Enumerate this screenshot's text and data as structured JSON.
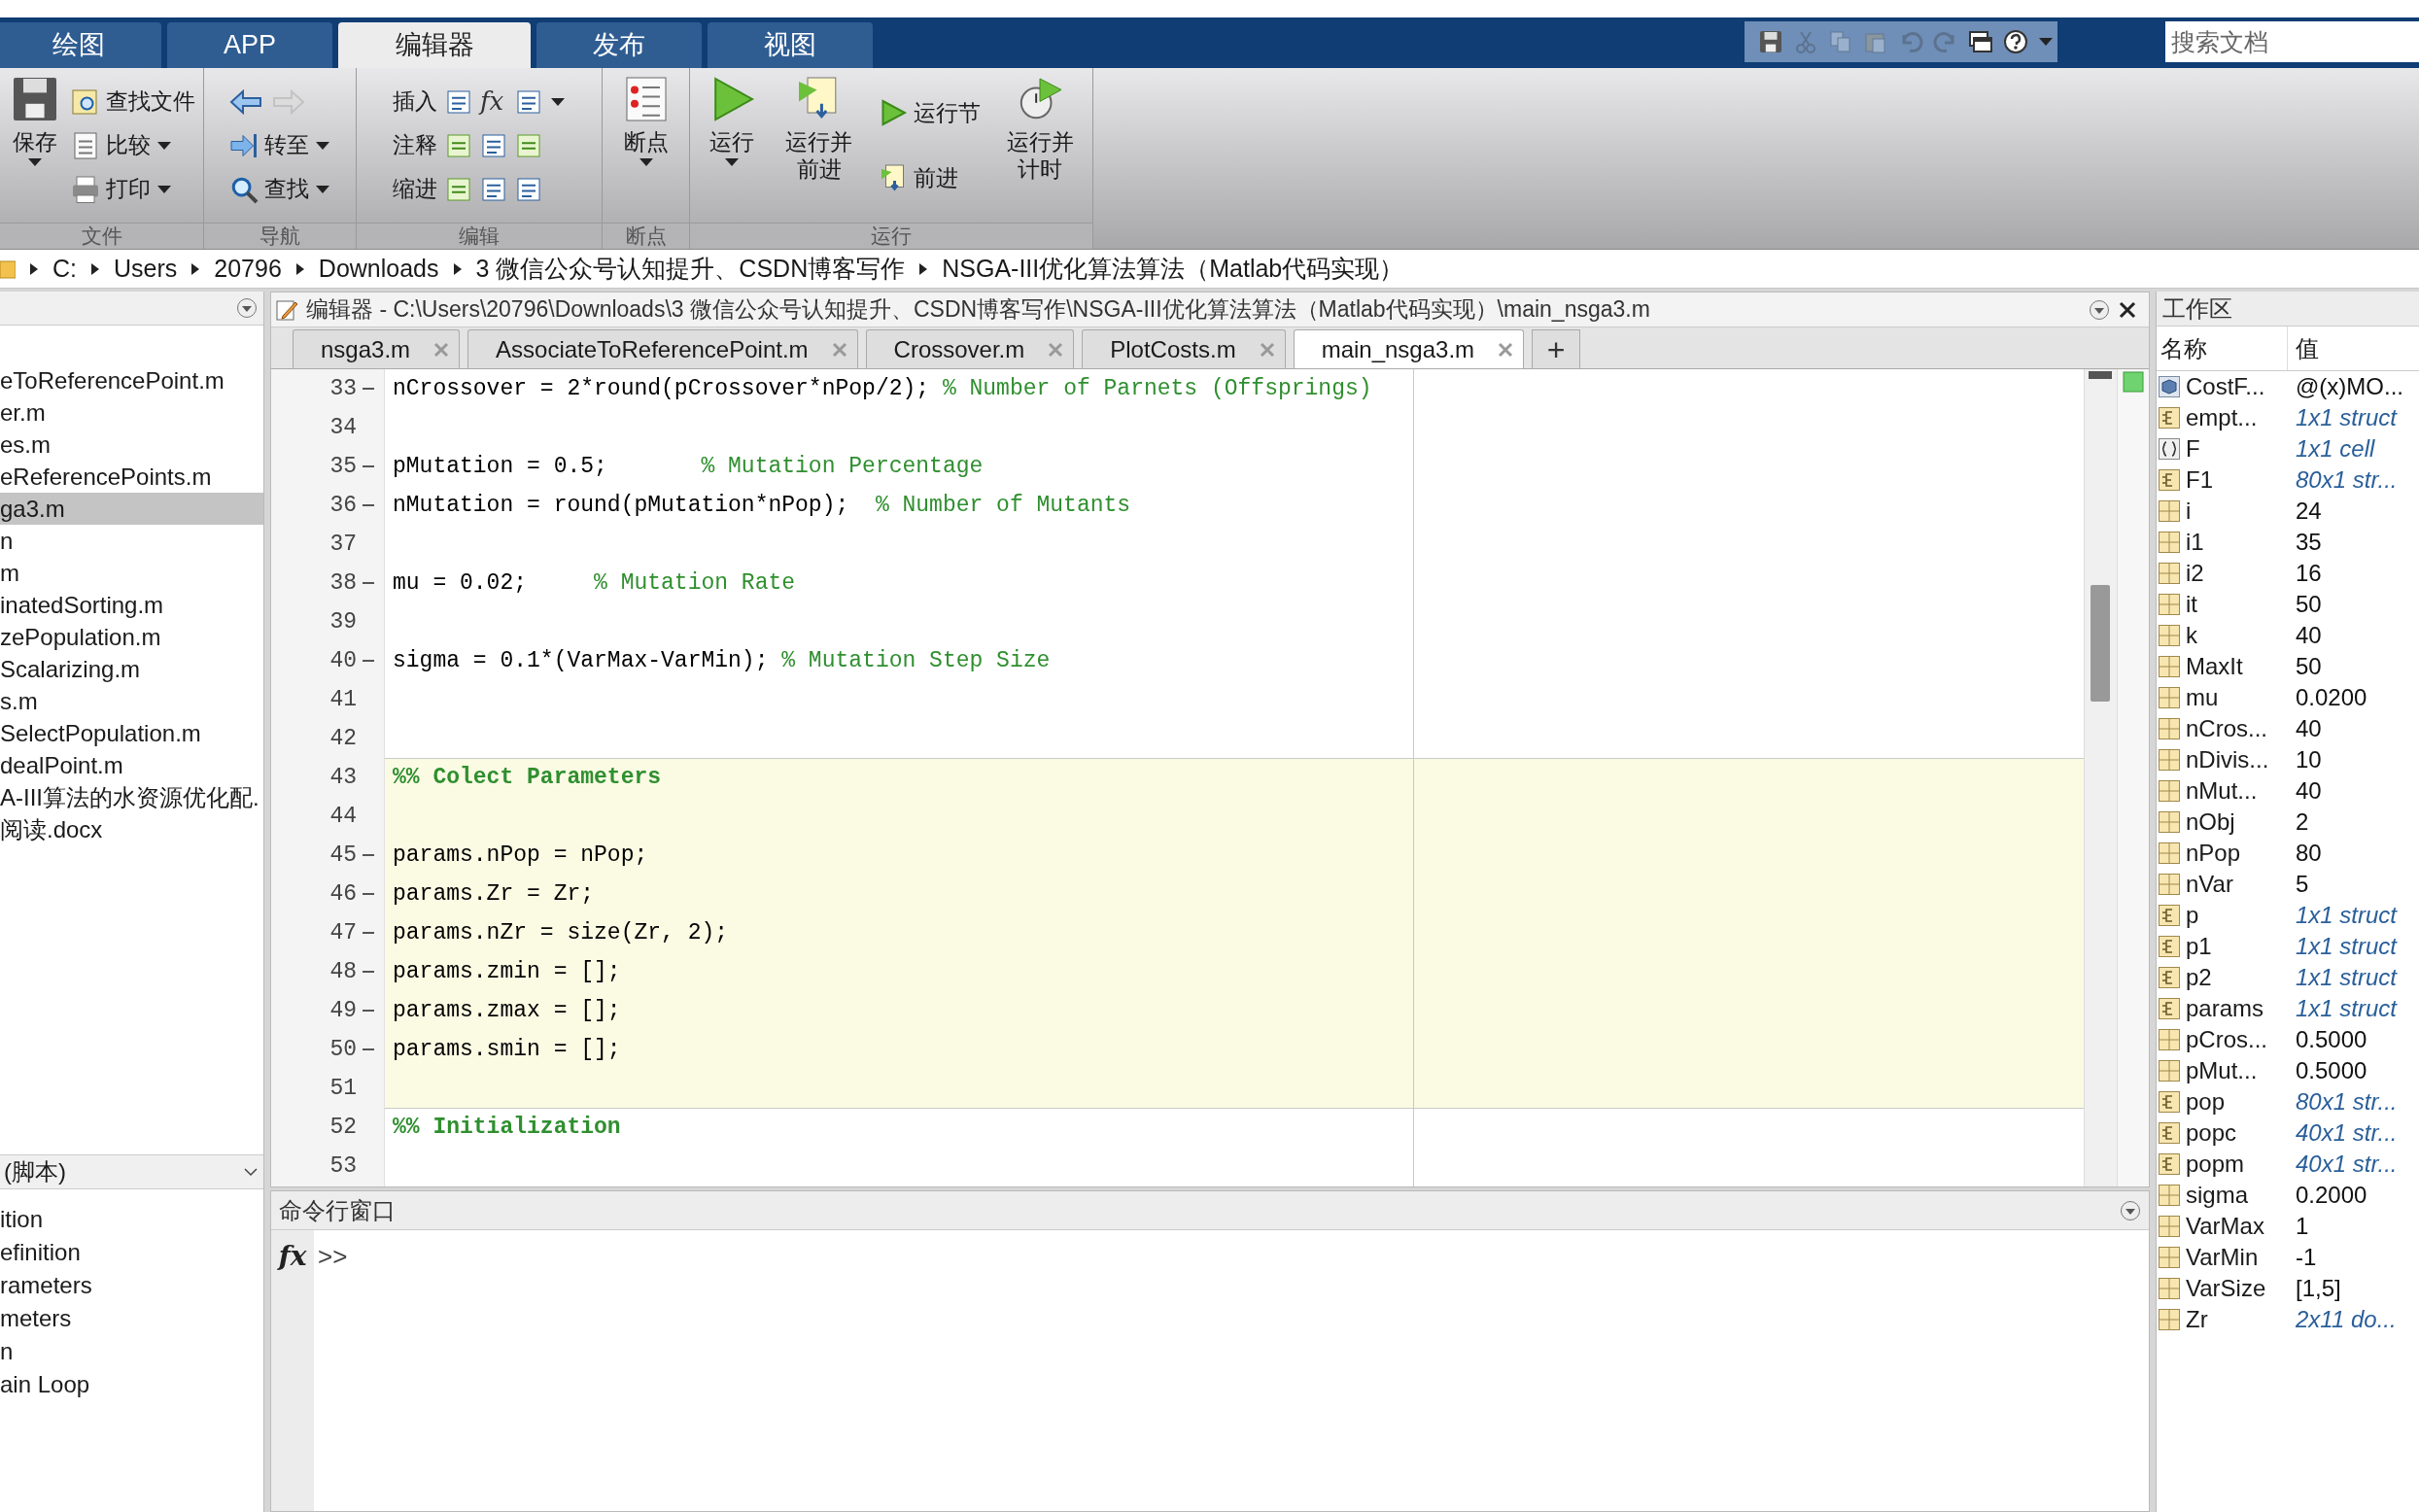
{
  "ribbon_tabs": [
    {
      "label": "绘图",
      "selected": false
    },
    {
      "label": "APP",
      "selected": false
    },
    {
      "label": "编辑器",
      "selected": true
    },
    {
      "label": "发布",
      "selected": false
    },
    {
      "label": "视图",
      "selected": false
    }
  ],
  "quick_access": [
    {
      "disabled": false
    },
    {
      "disabled": true
    },
    {
      "disabled": true
    },
    {
      "disabled": true
    },
    {
      "disabled": true
    },
    {
      "disabled": true
    },
    {
      "disabled": false
    },
    {
      "disabled": false
    }
  ],
  "search": {
    "placeholder": "搜索文档"
  },
  "ribbon_groups": [
    {
      "label": "文件",
      "columns": [
        {
          "kind": "large",
          "label_lines": [
            "保存"
          ],
          "dropdown": true
        },
        {
          "kind": "stack",
          "items": [
            {
              "kind": "command",
              "label": "查找文件",
              "dropdown": false
            },
            {
              "kind": "command",
              "label": "比较",
              "dropdown": true
            },
            {
              "kind": "command",
              "label": "打印",
              "dropdown": true
            }
          ]
        }
      ]
    },
    {
      "label": "导航",
      "columns": [
        {
          "kind": "stack",
          "items": [
            {
              "kind": "arrows",
              "forward_enabled": false
            },
            {
              "kind": "command",
              "label": "转至",
              "dropdown": true
            },
            {
              "kind": "command",
              "label": "查找",
              "dropdown": true
            }
          ]
        }
      ]
    },
    {
      "label": "编辑",
      "columns": [
        {
          "kind": "stack",
          "items": [
            {
              "kind": "edit_row",
              "label": "插入",
              "glyph": "fx",
              "dropdown": true
            },
            {
              "kind": "edit_row",
              "label": "注释",
              "dropdown": false
            },
            {
              "kind": "edit_row",
              "label": "缩进",
              "dropdown": false
            }
          ]
        }
      ]
    },
    {
      "label": "断点",
      "columns": [
        {
          "kind": "large",
          "label_lines": [
            "断点"
          ],
          "dropdown": true
        }
      ]
    },
    {
      "label": "运行",
      "columns": [
        {
          "kind": "large",
          "label_lines": [
            "运行"
          ],
          "dropdown": true
        },
        {
          "kind": "large",
          "label_lines": [
            "运行并",
            "前进"
          ],
          "dropdown": false
        },
        {
          "kind": "stack",
          "items": [
            {
              "kind": "command",
              "label": "运行节",
              "dropdown": false
            },
            {
              "kind": "command",
              "label": "前进",
              "dropdown": false
            }
          ]
        },
        {
          "kind": "large",
          "label_lines": [
            "运行并",
            "计时"
          ],
          "dropdown": false
        }
      ]
    }
  ],
  "address_bar": {
    "segments": [
      "C:",
      "Users",
      "20796",
      "Downloads",
      "3 微信公众号认知提升、CSDN博客写作",
      "NSGA-III优化算法算法（Matlab代码实现）"
    ]
  },
  "file_browser": {
    "files": [
      {
        "name": "eToReferencePoint.m",
        "selected": false
      },
      {
        "name": "er.m",
        "selected": false
      },
      {
        "name": "es.m",
        "selected": false
      },
      {
        "name": "eReferencePoints.m",
        "selected": false
      },
      {
        "name": "ga3.m",
        "selected": true
      },
      {
        "name": "n",
        "selected": false
      },
      {
        "name": "m",
        "selected": false
      },
      {
        "name": "inatedSorting.m",
        "selected": false
      },
      {
        "name": "zePopulation.m",
        "selected": false
      },
      {
        "name": "Scalarizing.m",
        "selected": false
      },
      {
        "name": "s.m",
        "selected": false
      },
      {
        "name": "SelectPopulation.m",
        "selected": false
      },
      {
        "name": "dealPoint.m",
        "selected": false
      },
      {
        "name": "A-III算法的水资源优化配.",
        "selected": false
      },
      {
        "name": "阅读.docx",
        "selected": false
      }
    ],
    "details_title": "(脚本)",
    "sections": [
      "ition",
      "efinition",
      "rameters",
      "meters",
      "n",
      "ain Loop"
    ]
  },
  "editor": {
    "title": "编辑器 - C:\\Users\\20796\\Downloads\\3 微信公众号认知提升、CSDN博客写作\\NSGA-III优化算法算法（Matlab代码实现）\\main_nsga3.m",
    "tabs": [
      {
        "label": "nsga3.m",
        "selected": false
      },
      {
        "label": "AssociateToReferencePoint.m",
        "selected": false
      },
      {
        "label": "Crossover.m",
        "selected": false
      },
      {
        "label": "PlotCosts.m",
        "selected": false
      },
      {
        "label": "main_nsga3.m",
        "selected": true
      }
    ],
    "new_tab": "+",
    "lines": [
      {
        "number": "33",
        "kind": "code",
        "executable": true,
        "highlighted": false,
        "code": "nCrossover = 2*round(pCrossover*nPop/2); ",
        "comment": "% Number of Parnets (Offsprings)"
      },
      {
        "number": "34",
        "kind": "blank",
        "executable": false,
        "highlighted": false
      },
      {
        "number": "35",
        "kind": "code",
        "executable": true,
        "highlighted": false,
        "code": "pMutation = 0.5;       ",
        "comment": "% Mutation Percentage"
      },
      {
        "number": "36",
        "kind": "code",
        "executable": true,
        "highlighted": false,
        "code": "nMutation = round(pMutation*nPop);  ",
        "comment": "% Number of Mutants"
      },
      {
        "number": "37",
        "kind": "blank",
        "executable": false,
        "highlighted": false
      },
      {
        "number": "38",
        "kind": "code",
        "executable": true,
        "highlighted": false,
        "code": "mu = 0.02;     ",
        "comment": "% Mutation Rate"
      },
      {
        "number": "39",
        "kind": "blank",
        "executable": false,
        "highlighted": false
      },
      {
        "number": "40",
        "kind": "code",
        "executable": true,
        "highlighted": false,
        "code": "sigma = 0.1*(VarMax-VarMin); ",
        "comment": "% Mutation Step Size"
      },
      {
        "number": "41",
        "kind": "blank",
        "executable": false,
        "highlighted": false
      },
      {
        "number": "42",
        "kind": "blank",
        "executable": false,
        "highlighted": false
      },
      {
        "number": "43",
        "kind": "section",
        "executable": false,
        "highlighted": true,
        "code": "%% Colect Parameters"
      },
      {
        "number": "44",
        "kind": "blank",
        "executable": false,
        "highlighted": true
      },
      {
        "number": "45",
        "kind": "code",
        "executable": true,
        "highlighted": true,
        "code": "params.nPop = nPop;"
      },
      {
        "number": "46",
        "kind": "code",
        "executable": true,
        "highlighted": true,
        "code": "params.Zr = Zr;"
      },
      {
        "number": "47",
        "kind": "code",
        "executable": true,
        "highlighted": true,
        "code": "params.nZr = size(Zr, 2);"
      },
      {
        "number": "48",
        "kind": "code",
        "executable": true,
        "highlighted": true,
        "code": "params.zmin = [];"
      },
      {
        "number": "49",
        "kind": "code",
        "executable": true,
        "highlighted": true,
        "code": "params.zmax = [];"
      },
      {
        "number": "50",
        "kind": "code",
        "executable": true,
        "highlighted": true,
        "code": "params.smin = [];"
      },
      {
        "number": "51",
        "kind": "blank",
        "executable": false,
        "highlighted": true
      },
      {
        "number": "52",
        "kind": "section",
        "executable": false,
        "highlighted": false,
        "code": "%% Initialization"
      },
      {
        "number": "53",
        "kind": "blank",
        "executable": false,
        "highlighted": false
      }
    ]
  },
  "command_window": {
    "title": "命令行窗口",
    "function_glyph": "fx",
    "prompt": ">>"
  },
  "workspace": {
    "title": "工作区",
    "columns": [
      "名称",
      "值"
    ],
    "variables": [
      {
        "name": "CostF...",
        "value": "@(x)MO...",
        "kind": "function_handle",
        "summary": false
      },
      {
        "name": "empt...",
        "value": "1x1 struct",
        "kind": "struct",
        "summary": true
      },
      {
        "name": "F",
        "value": "1x1 cell",
        "kind": "cell",
        "summary": true
      },
      {
        "name": "F1",
        "value": "80x1 str...",
        "kind": "struct",
        "summary": true
      },
      {
        "name": "i",
        "value": "24",
        "kind": "numeric",
        "summary": false
      },
      {
        "name": "i1",
        "value": "35",
        "kind": "numeric",
        "summary": false
      },
      {
        "name": "i2",
        "value": "16",
        "kind": "numeric",
        "summary": false
      },
      {
        "name": "it",
        "value": "50",
        "kind": "numeric",
        "summary": false
      },
      {
        "name": "k",
        "value": "40",
        "kind": "numeric",
        "summary": false
      },
      {
        "name": "MaxIt",
        "value": "50",
        "kind": "numeric",
        "summary": false
      },
      {
        "name": "mu",
        "value": "0.0200",
        "kind": "numeric",
        "summary": false
      },
      {
        "name": "nCros...",
        "value": "40",
        "kind": "numeric",
        "summary": false
      },
      {
        "name": "nDivis...",
        "value": "10",
        "kind": "numeric",
        "summary": false
      },
      {
        "name": "nMut...",
        "value": "40",
        "kind": "numeric",
        "summary": false
      },
      {
        "name": "nObj",
        "value": "2",
        "kind": "numeric",
        "summary": false
      },
      {
        "name": "nPop",
        "value": "80",
        "kind": "numeric",
        "summary": false
      },
      {
        "name": "nVar",
        "value": "5",
        "kind": "numeric",
        "summary": false
      },
      {
        "name": "p",
        "value": "1x1 struct",
        "kind": "struct",
        "summary": true
      },
      {
        "name": "p1",
        "value": "1x1 struct",
        "kind": "struct",
        "summary": true
      },
      {
        "name": "p2",
        "value": "1x1 struct",
        "kind": "struct",
        "summary": true
      },
      {
        "name": "params",
        "value": "1x1 struct",
        "kind": "struct",
        "summary": true
      },
      {
        "name": "pCros...",
        "value": "0.5000",
        "kind": "numeric",
        "summary": false
      },
      {
        "name": "pMut...",
        "value": "0.5000",
        "kind": "numeric",
        "summary": false
      },
      {
        "name": "pop",
        "value": "80x1 str...",
        "kind": "struct",
        "summary": true
      },
      {
        "name": "popc",
        "value": "40x1 str...",
        "kind": "struct",
        "summary": true
      },
      {
        "name": "popm",
        "value": "40x1 str...",
        "kind": "struct",
        "summary": true
      },
      {
        "name": "sigma",
        "value": "0.2000",
        "kind": "numeric",
        "summary": false
      },
      {
        "name": "VarMax",
        "value": "1",
        "kind": "numeric",
        "summary": false
      },
      {
        "name": "VarMin",
        "value": "-1",
        "kind": "numeric",
        "summary": false
      },
      {
        "name": "VarSize",
        "value": "[1,5]",
        "kind": "numeric",
        "summary": false
      },
      {
        "name": "Zr",
        "value": "2x11 do...",
        "kind": "numeric",
        "summary": true
      }
    ]
  }
}
